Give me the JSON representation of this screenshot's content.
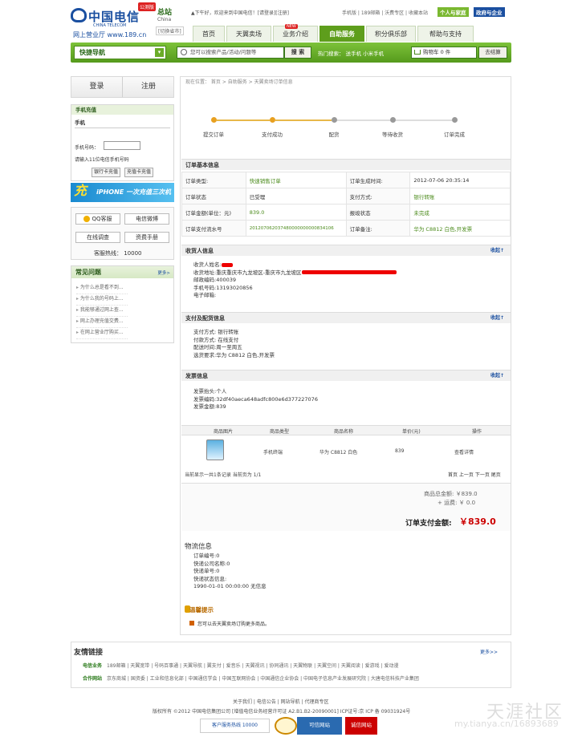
{
  "header": {
    "logo_cn": "中国电信",
    "logo_en": "CHINA TELECOM",
    "logo_sub": "网上营业厅 www.189.cn",
    "beta": "公测版",
    "station": "总站",
    "station_en": "China",
    "city_switch": "[切换省市]",
    "welcome": "▲下午好，欢迎来到中国电信！[请登录][注册]",
    "toplinks": "手机版 | 189邮箱 | 沃费专区 | 收藏本站",
    "pill_personal": "个人与家庭",
    "pill_gov": "政府与企业"
  },
  "nav": {
    "tabs": [
      "首页",
      "天翼卖场",
      "业务介绍",
      "自助服务",
      "积分俱乐部",
      "帮助与支持"
    ],
    "active": 3,
    "hot": "NEW"
  },
  "searchbar": {
    "quicknav": "快捷导航",
    "placeholder": "您可以搜索产品/活动/问题等",
    "search_btn": "搜 索",
    "hot_keywords": "热门搜索： 送手机  小米手机",
    "cart": "购物车 0 件",
    "checkout": "去结算"
  },
  "sidebar": {
    "login": "登录",
    "register": "注册",
    "recharge_title": "手机充值",
    "recharge_tab": "手机",
    "phone_label": "手机号码：",
    "phone_hint": "请输入11位电信手机号码",
    "btn_card": "银行卡充值",
    "btn_prepaid": "充值卡充值",
    "banner_big": "充",
    "banner_text": "iPHONE 一次充值三次机会",
    "qq": "QQ客服",
    "weibo": "电信微博",
    "online": "在线调查",
    "fees": "资费手册",
    "hotline": "客服热线： 10000",
    "faq_title": "常见问题",
    "faq_more": "更多>",
    "faq": [
      "为什么总是看不到...",
      "为什么我的号码上...",
      "我能够通过网上查...",
      "网上办理充值交费...",
      "在网上营业厅购买..."
    ]
  },
  "breadcrumb": "现在位置： 首页 > 自助服务 > 天翼卖场订单信息",
  "steps": [
    "提交订单",
    "支付成功",
    "配货",
    "等待收货",
    "订单完成"
  ],
  "steps_done": 2,
  "order": {
    "title": "订单基本信息",
    "rows": [
      [
        "订单类型:",
        "快速销售订单",
        "订单生成时间:",
        "2012-07-06 20:35:14"
      ],
      [
        "订单状态",
        "已受理",
        "支付方式:",
        "银行转账"
      ],
      [
        "订单金额(单位：元)",
        "839.0",
        "报竣状态",
        "未完成"
      ],
      [
        "订单支付流水号",
        "201207062037480000000000834106",
        "订单备注:",
        "华为 C8812 白色,开发票"
      ]
    ]
  },
  "receiver": {
    "title": "收货人信息",
    "fold": "收起↑",
    "lines": [
      "收货人姓名:",
      "收货地址:重庆重庆市九龙坡区-重庆市九龙坡区",
      "邮政编码:400039",
      "手机号码:13193020856",
      "电子邮箱:"
    ]
  },
  "payment": {
    "title": "支付及配货信息",
    "fold": "收起↑",
    "lines": [
      "支付方式: 银行转账",
      "付款方式: 在线支付",
      "配送时间:周一至周五",
      "选货要求:华为 C8812 白色,开发票"
    ]
  },
  "invoice": {
    "title": "发票信息",
    "fold": "收起↑",
    "lines": [
      "发票抬头:个人",
      "发票编码:32df40aeca648adfc800e6d377227076",
      "发票金额:839"
    ]
  },
  "goods": {
    "headers": [
      "商品图片",
      "商品类型",
      "商品名称",
      "单价(元)",
      "操作"
    ],
    "row": [
      "手机终端",
      "华为 C8812 白色",
      "839",
      "查看详情"
    ],
    "pager_left": "当前显示一共1条记录 当前页为 1/1",
    "pager_right": "首页 上一页 下一页 尾页"
  },
  "totals": {
    "goods": "商品总金额: ￥839.0",
    "shipping": "+ 运费: ￥ 0.0",
    "grand_label": "订单支付金额:",
    "grand_value": "￥839.0"
  },
  "logistics": {
    "title": "物流信息",
    "lines": [
      "订单编号:0",
      "快递公司名称:0",
      "快递单号:0",
      "快递状态信息:",
      "1990-01-01 00:00:00 无信息"
    ]
  },
  "tips": {
    "title": "温馨提示",
    "text": "您可以去天翼卖场订购更多商品。"
  },
  "footer": {
    "friend_title": "友情链接",
    "more": "更多>>",
    "row1_label": "电信业务",
    "row1": "189邮箱 | 天翼宽带 | 号码百事通 | 天翼导航 | 翼支付 | 爱音乐 | 天翼视讯 | 协同通讯 | 天翼物联 | 天翼空间 | 天翼阅读 | 爱游戏 | 爱动漫",
    "row2_label": "合作网站",
    "row2": "京东商城 | 国资委 | 工业和信息化部 | 中国通信学会 | 中国互联网协会 | 中国通信企业协会 | 中国电子信息产业发展研究院 | 大唐电信科技产业集团",
    "links": "关于我们 | 电信公告 | 网站导航 | 代理商专区",
    "copyright": "版权所有 ©2012 中国电信集团公司 [增值电信业务经营许可证 A2.B1.B2-20090001] ICP证号:京 ICP 备 09031924号",
    "hotline": "客户服务热线 10000",
    "badge_trust": "可信网站",
    "badge_cert": "诚信网站",
    "watermark": "天涯社区",
    "watermark_url": "my.tianya.cn/16893689"
  }
}
